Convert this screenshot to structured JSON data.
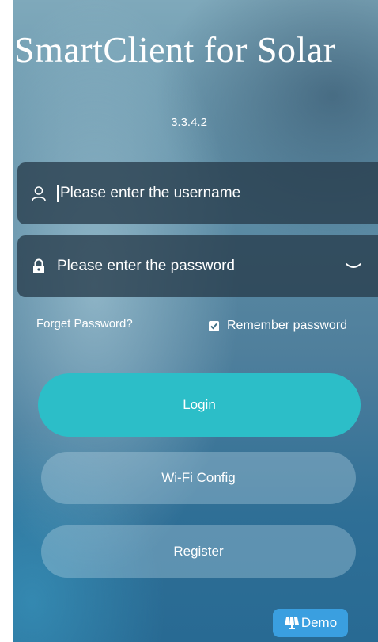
{
  "app": {
    "title": "SmartClient for Solar",
    "version": "3.3.4.2"
  },
  "login_form": {
    "username": {
      "value": "",
      "placeholder": "Please enter the username",
      "icon": "user-icon"
    },
    "password": {
      "value": "",
      "placeholder": "Please enter the password",
      "icon": "lock-icon",
      "toggle_icon": "eye-closed-icon"
    },
    "forget_password_label": "Forget Password?",
    "remember_password": {
      "label": "Remember password",
      "checked": true
    }
  },
  "buttons": {
    "login_label": "Login",
    "wifi_config_label": "Wi-Fi Config",
    "register_label": "Register",
    "demo_label": "Demo",
    "demo_icon": "solar-panel-icon"
  },
  "colors": {
    "login_button": "#2cbec8",
    "demo_button": "#3a9fe0"
  }
}
